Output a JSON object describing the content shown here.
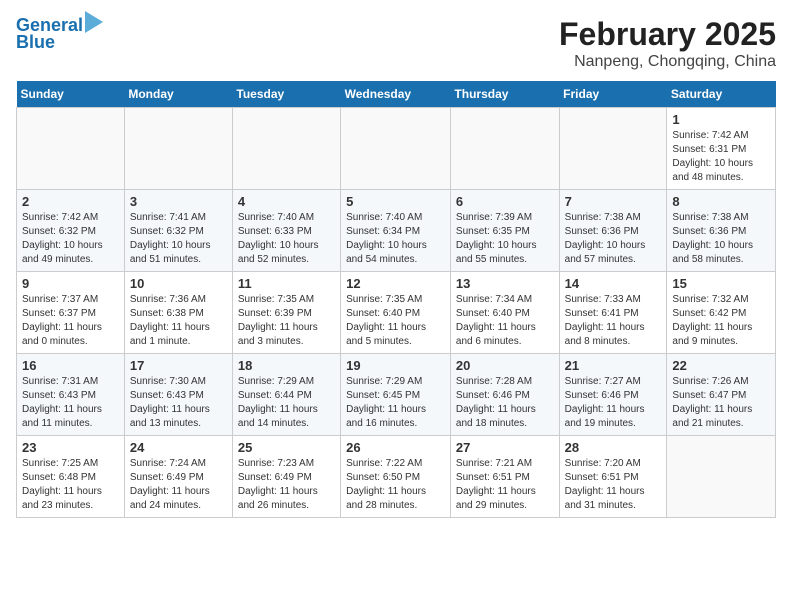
{
  "header": {
    "logo_line1": "General",
    "logo_line2": "Blue",
    "month_year": "February 2025",
    "location": "Nanpeng, Chongqing, China"
  },
  "weekdays": [
    "Sunday",
    "Monday",
    "Tuesday",
    "Wednesday",
    "Thursday",
    "Friday",
    "Saturday"
  ],
  "weeks": [
    [
      {
        "day": "",
        "info": ""
      },
      {
        "day": "",
        "info": ""
      },
      {
        "day": "",
        "info": ""
      },
      {
        "day": "",
        "info": ""
      },
      {
        "day": "",
        "info": ""
      },
      {
        "day": "",
        "info": ""
      },
      {
        "day": "1",
        "info": "Sunrise: 7:42 AM\nSunset: 6:31 PM\nDaylight: 10 hours\nand 48 minutes."
      }
    ],
    [
      {
        "day": "2",
        "info": "Sunrise: 7:42 AM\nSunset: 6:32 PM\nDaylight: 10 hours\nand 49 minutes."
      },
      {
        "day": "3",
        "info": "Sunrise: 7:41 AM\nSunset: 6:32 PM\nDaylight: 10 hours\nand 51 minutes."
      },
      {
        "day": "4",
        "info": "Sunrise: 7:40 AM\nSunset: 6:33 PM\nDaylight: 10 hours\nand 52 minutes."
      },
      {
        "day": "5",
        "info": "Sunrise: 7:40 AM\nSunset: 6:34 PM\nDaylight: 10 hours\nand 54 minutes."
      },
      {
        "day": "6",
        "info": "Sunrise: 7:39 AM\nSunset: 6:35 PM\nDaylight: 10 hours\nand 55 minutes."
      },
      {
        "day": "7",
        "info": "Sunrise: 7:38 AM\nSunset: 6:36 PM\nDaylight: 10 hours\nand 57 minutes."
      },
      {
        "day": "8",
        "info": "Sunrise: 7:38 AM\nSunset: 6:36 PM\nDaylight: 10 hours\nand 58 minutes."
      }
    ],
    [
      {
        "day": "9",
        "info": "Sunrise: 7:37 AM\nSunset: 6:37 PM\nDaylight: 11 hours\nand 0 minutes."
      },
      {
        "day": "10",
        "info": "Sunrise: 7:36 AM\nSunset: 6:38 PM\nDaylight: 11 hours\nand 1 minute."
      },
      {
        "day": "11",
        "info": "Sunrise: 7:35 AM\nSunset: 6:39 PM\nDaylight: 11 hours\nand 3 minutes."
      },
      {
        "day": "12",
        "info": "Sunrise: 7:35 AM\nSunset: 6:40 PM\nDaylight: 11 hours\nand 5 minutes."
      },
      {
        "day": "13",
        "info": "Sunrise: 7:34 AM\nSunset: 6:40 PM\nDaylight: 11 hours\nand 6 minutes."
      },
      {
        "day": "14",
        "info": "Sunrise: 7:33 AM\nSunset: 6:41 PM\nDaylight: 11 hours\nand 8 minutes."
      },
      {
        "day": "15",
        "info": "Sunrise: 7:32 AM\nSunset: 6:42 PM\nDaylight: 11 hours\nand 9 minutes."
      }
    ],
    [
      {
        "day": "16",
        "info": "Sunrise: 7:31 AM\nSunset: 6:43 PM\nDaylight: 11 hours\nand 11 minutes."
      },
      {
        "day": "17",
        "info": "Sunrise: 7:30 AM\nSunset: 6:43 PM\nDaylight: 11 hours\nand 13 minutes."
      },
      {
        "day": "18",
        "info": "Sunrise: 7:29 AM\nSunset: 6:44 PM\nDaylight: 11 hours\nand 14 minutes."
      },
      {
        "day": "19",
        "info": "Sunrise: 7:29 AM\nSunset: 6:45 PM\nDaylight: 11 hours\nand 16 minutes."
      },
      {
        "day": "20",
        "info": "Sunrise: 7:28 AM\nSunset: 6:46 PM\nDaylight: 11 hours\nand 18 minutes."
      },
      {
        "day": "21",
        "info": "Sunrise: 7:27 AM\nSunset: 6:46 PM\nDaylight: 11 hours\nand 19 minutes."
      },
      {
        "day": "22",
        "info": "Sunrise: 7:26 AM\nSunset: 6:47 PM\nDaylight: 11 hours\nand 21 minutes."
      }
    ],
    [
      {
        "day": "23",
        "info": "Sunrise: 7:25 AM\nSunset: 6:48 PM\nDaylight: 11 hours\nand 23 minutes."
      },
      {
        "day": "24",
        "info": "Sunrise: 7:24 AM\nSunset: 6:49 PM\nDaylight: 11 hours\nand 24 minutes."
      },
      {
        "day": "25",
        "info": "Sunrise: 7:23 AM\nSunset: 6:49 PM\nDaylight: 11 hours\nand 26 minutes."
      },
      {
        "day": "26",
        "info": "Sunrise: 7:22 AM\nSunset: 6:50 PM\nDaylight: 11 hours\nand 28 minutes."
      },
      {
        "day": "27",
        "info": "Sunrise: 7:21 AM\nSunset: 6:51 PM\nDaylight: 11 hours\nand 29 minutes."
      },
      {
        "day": "28",
        "info": "Sunrise: 7:20 AM\nSunset: 6:51 PM\nDaylight: 11 hours\nand 31 minutes."
      },
      {
        "day": "",
        "info": ""
      }
    ]
  ]
}
